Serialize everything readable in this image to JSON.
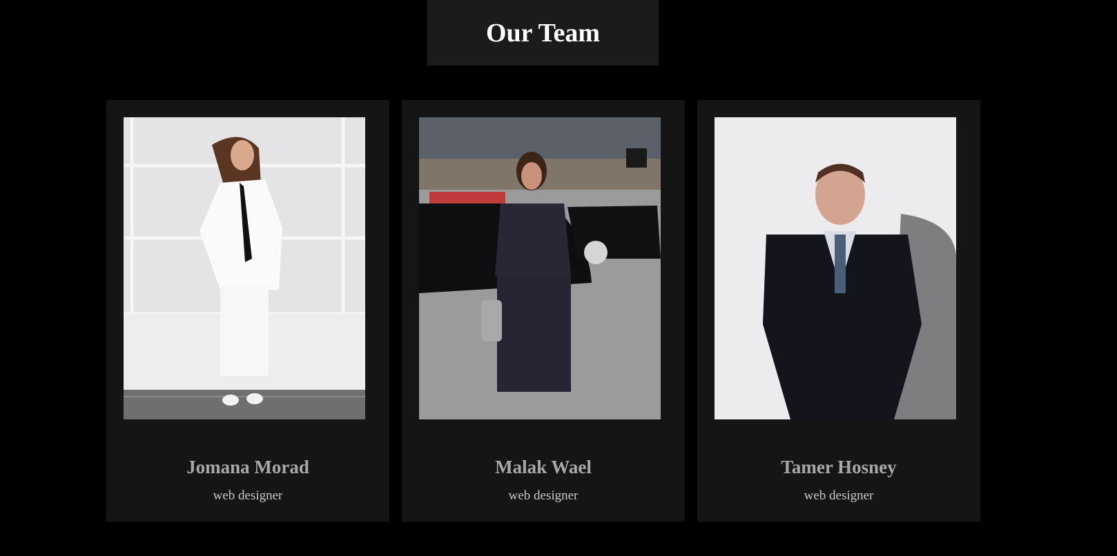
{
  "header": {
    "title": "Our Team"
  },
  "team": [
    {
      "name": "Jomana Morad",
      "role": "web designer"
    },
    {
      "name": "Malak Wael",
      "role": "web designer"
    },
    {
      "name": "Tamer Hosney",
      "role": "web designer"
    }
  ],
  "colors": {
    "page_background": "#000000",
    "title_box": "#1c1b1c",
    "card_background": "#151515",
    "name_text": "#a8a8a8",
    "role_text": "#c8c8c8"
  }
}
